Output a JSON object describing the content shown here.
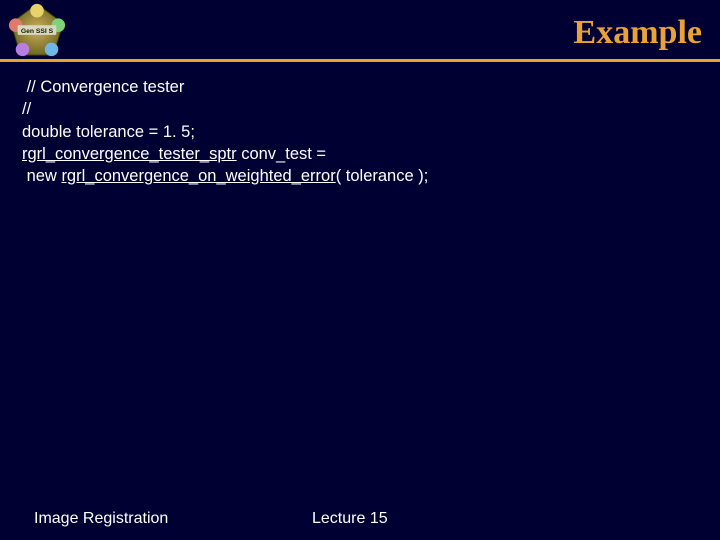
{
  "header": {
    "title": "Example"
  },
  "logo": {
    "band_text": "Gen SSI S"
  },
  "code": {
    "l1": " // Convergence tester",
    "l2": "//",
    "l3": "double tolerance = 1. 5;",
    "l4a": "rgrl_convergence_tester_sptr",
    "l4b": " conv_test =",
    "l5a": " new ",
    "l5b": "rgrl_convergence_on_weighted_error",
    "l5c": "( tolerance );"
  },
  "footer": {
    "left": "Image Registration",
    "mid": "Lecture 15"
  }
}
